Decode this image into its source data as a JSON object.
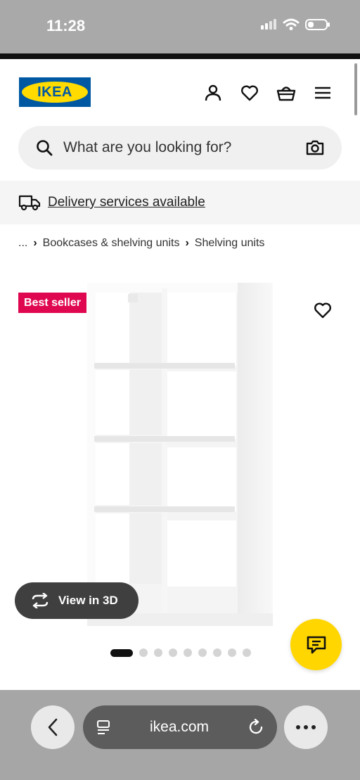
{
  "status_bar": {
    "time": "11:28"
  },
  "header": {
    "logo_text": "IKEA",
    "icons": [
      "account-icon",
      "heart-icon",
      "basket-icon",
      "menu-icon"
    ]
  },
  "search": {
    "placeholder": "What are you looking for?"
  },
  "delivery": {
    "text": "Delivery services available"
  },
  "breadcrumb": {
    "items": [
      "...",
      "Bookcases & shelving units",
      "Shelving units"
    ]
  },
  "product": {
    "badge": "Best seller",
    "view_3d_label": "View in 3D",
    "image_count": 10,
    "active_image": 1
  },
  "browser": {
    "url": "ikea.com"
  },
  "colors": {
    "ikea_blue": "#0058a3",
    "ikea_yellow": "#ffdb00",
    "badge_red": "#e00751",
    "chat_yellow": "#ffd600"
  }
}
